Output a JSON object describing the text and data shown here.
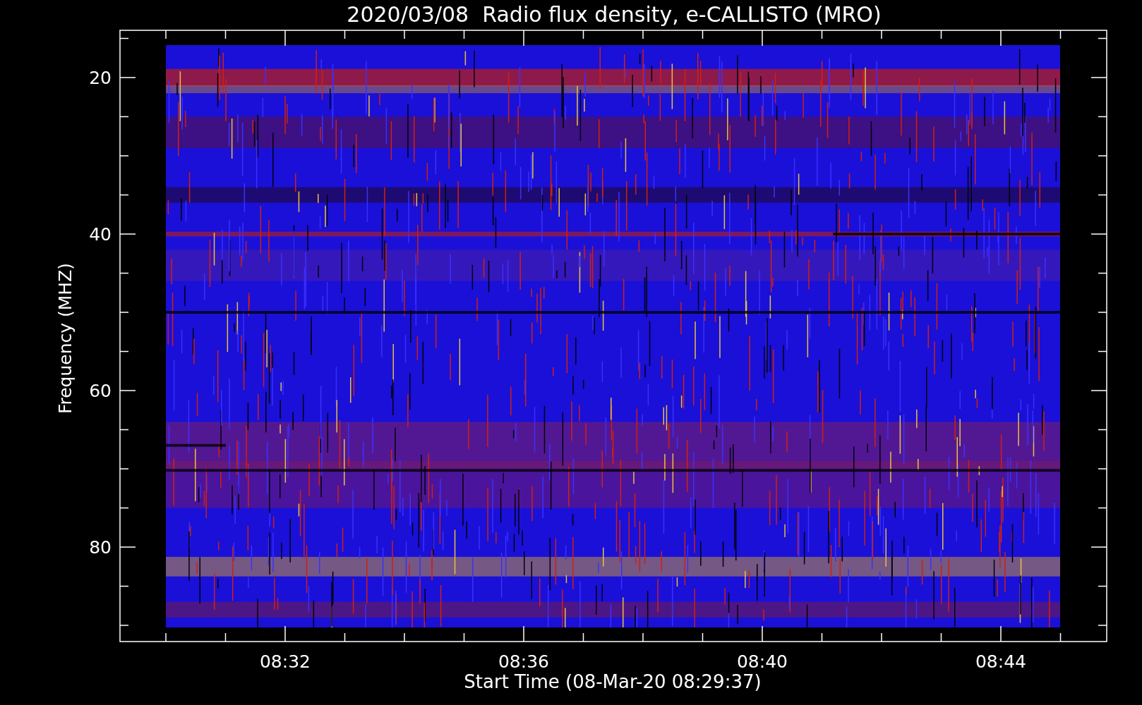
{
  "title": "2020/03/08  Radio flux density, e-CALLISTO (MRO)",
  "y_axis": {
    "label": "Frequency (MHZ)",
    "ticks": [
      "20",
      "40",
      "60",
      "80"
    ]
  },
  "x_axis": {
    "label": "Start Time (08-Mar-20 08:29:37)",
    "ticks": [
      "08:32",
      "08:36",
      "08:40",
      "08:44"
    ]
  }
}
